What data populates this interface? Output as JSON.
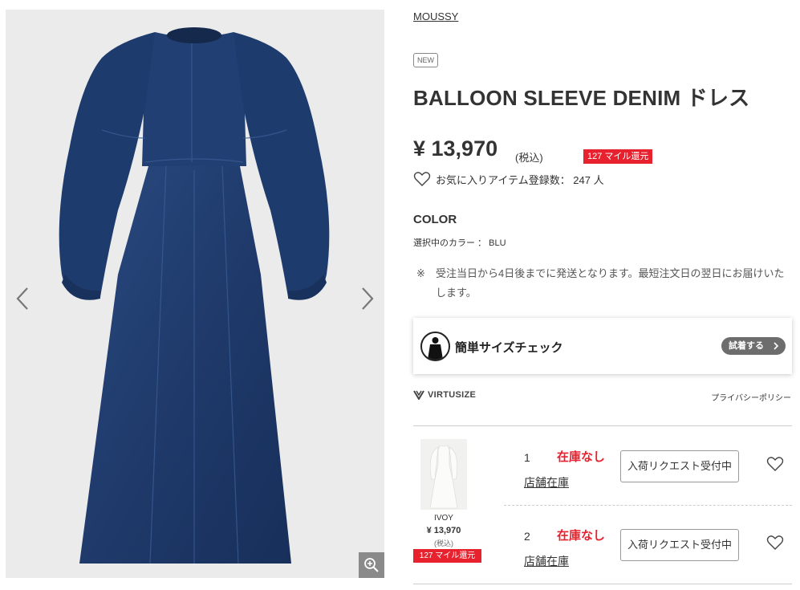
{
  "brand": "MOUSSY",
  "badge": "NEW",
  "product": {
    "name": "BALLOON SLEEVE DENIM ドレス",
    "price": "¥ 13,970",
    "tax_label": "(税込)",
    "mile_badge": "127 マイル還元"
  },
  "favorites": {
    "text": "お気に入りアイテム登録数： 247 人"
  },
  "color": {
    "heading": "COLOR",
    "selected": "選択中のカラー ： BLU"
  },
  "notice": {
    "mark": "※",
    "text": "受注当日から4日後までに発送となります。最短注文日の翌日にお届けいたします。"
  },
  "size_check": {
    "title": "簡単サイズチェック",
    "button": "試着する"
  },
  "virtusize": {
    "logo_text": "VIRTUSIZE",
    "privacy": "プライバシーポリシー"
  },
  "variant": {
    "name": "IVOY",
    "price": "¥ 13,970",
    "tax": "(税込)",
    "mile": "127 マイル還元"
  },
  "sizes": [
    {
      "size": "1",
      "stock": "在庫なし",
      "store_link": "店舗在庫",
      "request": "入荷リクエスト受付中"
    },
    {
      "size": "2",
      "stock": "在庫なし",
      "store_link": "店舗在庫",
      "request": "入荷リクエスト受付中"
    }
  ],
  "icons": {
    "prev": "chevron-left-icon",
    "next": "chevron-right-icon",
    "zoom": "zoom-in-icon",
    "favorite": "heart-icon"
  },
  "colors": {
    "accent_red": "#e8212e",
    "denim": "#1f3a6b",
    "text": "#333333"
  }
}
